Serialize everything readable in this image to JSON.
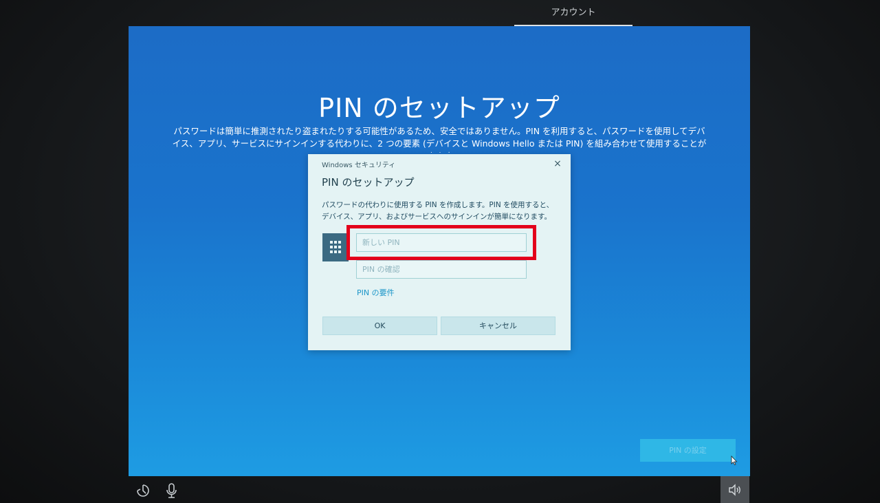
{
  "top_tab": {
    "label": "アカウント"
  },
  "screen": {
    "title": "PIN のセットアップ",
    "description": "パスワードは簡単に推測されたり盗まれたりする可能性があるため、安全ではありません。PIN を利用すると、パスワードを使用してデバイス、アプリ、サービスにサインインする代わりに、2 つの要素 (デバイスと Windows Hello または PIN) を組み合わせて使用することができます。",
    "setup_button": "PIN の設定"
  },
  "dialog": {
    "caption": "Windows セキュリティ",
    "close": "×",
    "title": "PIN のセットアップ",
    "description": "パスワードの代わりに使用する PIN を作成します。PIN を使用すると、デバイス、アプリ、およびサービスへのサインインが簡単になります。",
    "new_pin_placeholder": "新しい PIN",
    "confirm_pin_placeholder": "PIN の確認",
    "requirements_link": "PIN の要件",
    "ok_label": "OK",
    "cancel_label": "キャンセル"
  },
  "icons": {
    "keypad": "keypad-icon",
    "ease_of_access": "ease-of-access-icon",
    "microphone": "microphone-icon",
    "volume": "volume-icon",
    "cursor": "mouse-cursor-icon"
  }
}
